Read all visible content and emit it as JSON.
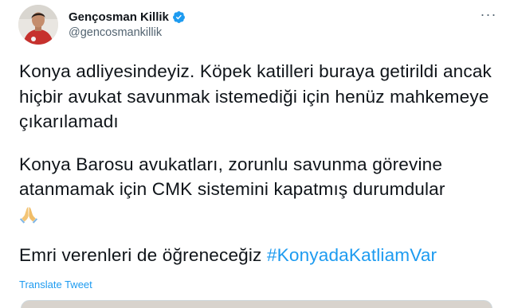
{
  "author": {
    "display_name": "Gençosman Killik",
    "handle": "@gencosmankillik",
    "verified": true
  },
  "tweet": {
    "paragraph1": "Konya adliyesindeyiz. Köpek katilleri buraya getirildi ancak hiçbir avukat savunmak istemediği için henüz mahkemeye çıkarılamadı",
    "paragraph2": "Konya Barosu avukatları, zorunlu savunma görevine atanmamak için CMK sistemini kapatmış durumdular",
    "paragraph2_emoji": "folded-hands-emoji",
    "paragraph3_text": "Emri verenleri de öğreneceğiz ",
    "hashtag": "#KonyadaKatliamVar"
  },
  "actions": {
    "translate_label": "Translate Tweet",
    "more_label": "···"
  },
  "colors": {
    "accent": "#1d9bf0",
    "text": "#0f1419",
    "secondary": "#536471"
  },
  "icons": {
    "verified": "verified-badge-icon",
    "more": "more-options-icon"
  }
}
